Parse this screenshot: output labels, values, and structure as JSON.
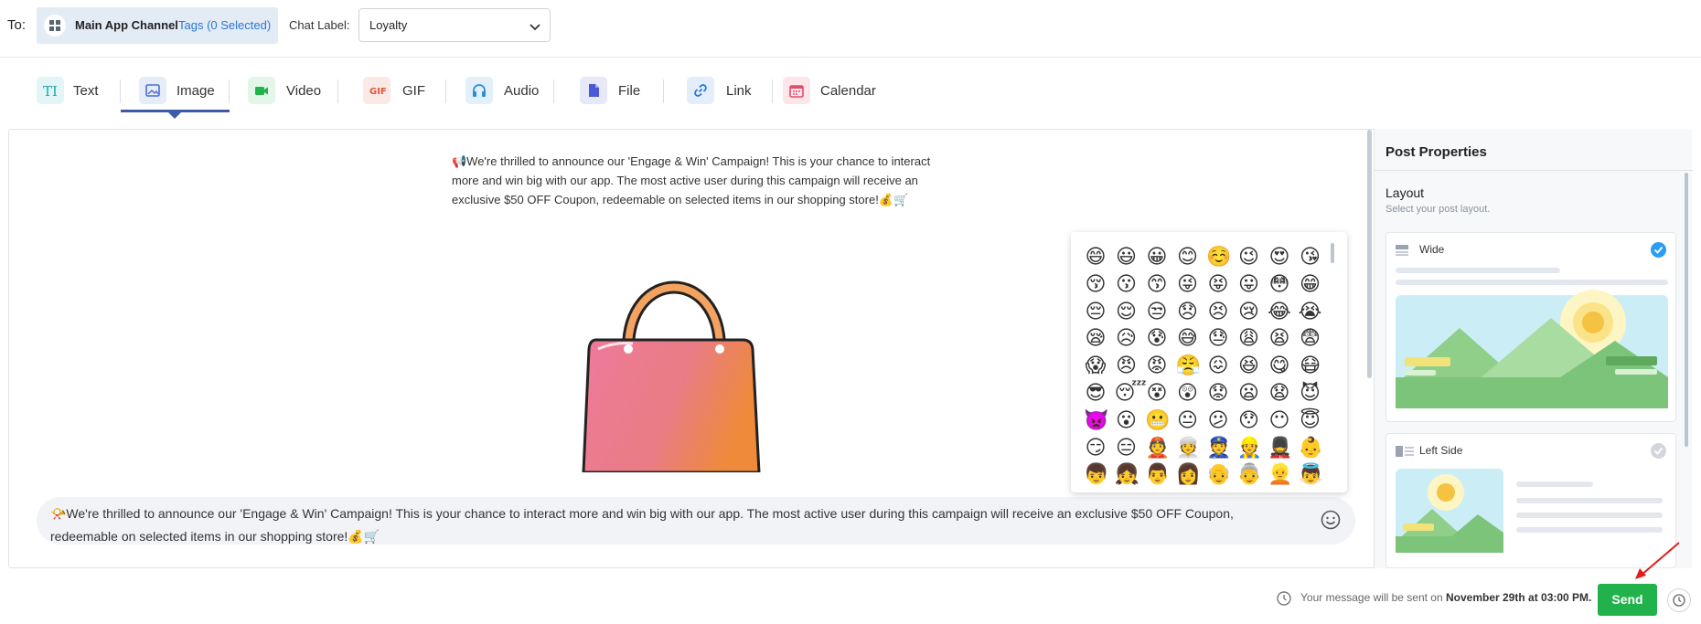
{
  "header": {
    "to_label": "To:",
    "channel_name": "Main App Channel",
    "channel_tags": "Tags (0 Selected)",
    "chat_label_title": "Chat Label:",
    "chat_label_value": "Loyalty"
  },
  "tabs": [
    {
      "label": "Text",
      "icon": "text-icon",
      "color": "#1ea7b5"
    },
    {
      "label": "Image",
      "icon": "image-icon",
      "color": "#4a6fd6",
      "active": true
    },
    {
      "label": "Video",
      "icon": "video-icon",
      "color": "#21b24b"
    },
    {
      "label": "GIF",
      "icon": "gif-icon",
      "color": "#e0563b"
    },
    {
      "label": "Audio",
      "icon": "headphones-icon",
      "color": "#2a8fd4"
    },
    {
      "label": "File",
      "icon": "file-icon",
      "color": "#4a5ad6"
    },
    {
      "label": "Link",
      "icon": "link-icon",
      "color": "#2a78d4"
    },
    {
      "label": "Calendar",
      "icon": "calendar-icon",
      "color": "#e24d6a"
    }
  ],
  "preview": {
    "text": "📢We're thrilled to announce our 'Engage & Win' Campaign! This is your chance to interact more and win big with our app. The most active user during this campaign will receive an exclusive $50 OFF Coupon, redeemable on selected items in our shopping store!💰🛒"
  },
  "composer": {
    "text": "📯We're thrilled to announce our 'Engage & Win' Campaign! This is your chance to interact more and win big with our app. The most active user during this campaign will receive an exclusive $50 OFF Coupon, redeemable on selected items in our shopping store!💰🛒"
  },
  "emoji_picker": {
    "emojis": [
      "😄",
      "😃",
      "😀",
      "😊",
      "☺️",
      "😉",
      "😍",
      "😘",
      "😚",
      "😗",
      "😙",
      "😜",
      "😝",
      "😛",
      "😳",
      "😁",
      "😔",
      "😌",
      "😒",
      "😞",
      "😣",
      "😢",
      "😂",
      "😭",
      "😪",
      "😥",
      "😰",
      "😅",
      "😓",
      "😩",
      "😫",
      "😨",
      "😱",
      "😠",
      "😡",
      "😤",
      "😖",
      "😆",
      "😋",
      "😷",
      "😎",
      "😴",
      "😵",
      "😲",
      "😟",
      "😦",
      "😧",
      "😈",
      "👿",
      "😮",
      "😬",
      "😐",
      "😕",
      "😯",
      "😶",
      "😇",
      "😏",
      "😑",
      "👲",
      "👳",
      "👮",
      "👷",
      "💂",
      "👶",
      "👦",
      "👧",
      "👨",
      "👩",
      "👴",
      "👵",
      "👱",
      "👼"
    ]
  },
  "properties": {
    "title": "Post Properties",
    "layout_title": "Layout",
    "layout_subtitle": "Select your post layout.",
    "options": [
      {
        "label": "Wide",
        "selected": true
      },
      {
        "label": "Left Side",
        "selected": false
      }
    ]
  },
  "footer": {
    "schedule_prefix": "Your message will be sent on ",
    "schedule_time": "November 29th at 03:00 PM.",
    "send_label": "Send"
  },
  "colors": {
    "accent": "#3d5aa8",
    "send": "#21b24b",
    "check": "#2a9df4"
  }
}
